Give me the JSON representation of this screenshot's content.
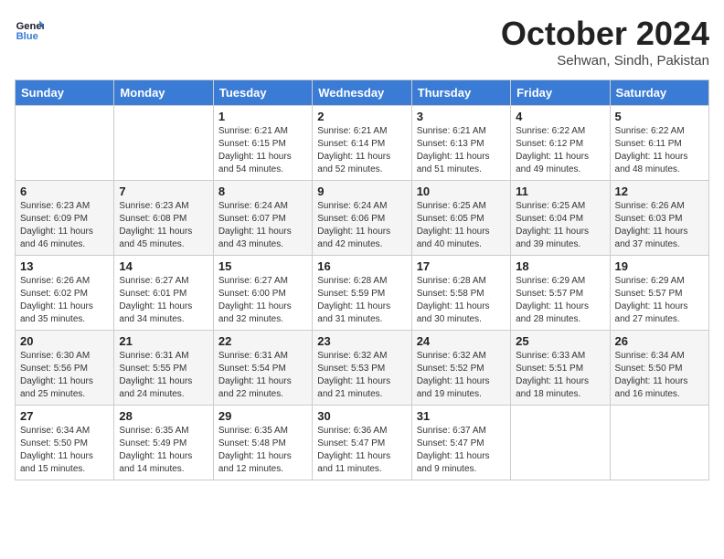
{
  "header": {
    "logo_line1": "General",
    "logo_line2": "Blue",
    "month_title": "October 2024",
    "location": "Sehwan, Sindh, Pakistan"
  },
  "days_of_week": [
    "Sunday",
    "Monday",
    "Tuesday",
    "Wednesday",
    "Thursday",
    "Friday",
    "Saturday"
  ],
  "weeks": [
    [
      {
        "num": "",
        "info": ""
      },
      {
        "num": "",
        "info": ""
      },
      {
        "num": "1",
        "info": "Sunrise: 6:21 AM\nSunset: 6:15 PM\nDaylight: 11 hours and 54 minutes."
      },
      {
        "num": "2",
        "info": "Sunrise: 6:21 AM\nSunset: 6:14 PM\nDaylight: 11 hours and 52 minutes."
      },
      {
        "num": "3",
        "info": "Sunrise: 6:21 AM\nSunset: 6:13 PM\nDaylight: 11 hours and 51 minutes."
      },
      {
        "num": "4",
        "info": "Sunrise: 6:22 AM\nSunset: 6:12 PM\nDaylight: 11 hours and 49 minutes."
      },
      {
        "num": "5",
        "info": "Sunrise: 6:22 AM\nSunset: 6:11 PM\nDaylight: 11 hours and 48 minutes."
      }
    ],
    [
      {
        "num": "6",
        "info": "Sunrise: 6:23 AM\nSunset: 6:09 PM\nDaylight: 11 hours and 46 minutes."
      },
      {
        "num": "7",
        "info": "Sunrise: 6:23 AM\nSunset: 6:08 PM\nDaylight: 11 hours and 45 minutes."
      },
      {
        "num": "8",
        "info": "Sunrise: 6:24 AM\nSunset: 6:07 PM\nDaylight: 11 hours and 43 minutes."
      },
      {
        "num": "9",
        "info": "Sunrise: 6:24 AM\nSunset: 6:06 PM\nDaylight: 11 hours and 42 minutes."
      },
      {
        "num": "10",
        "info": "Sunrise: 6:25 AM\nSunset: 6:05 PM\nDaylight: 11 hours and 40 minutes."
      },
      {
        "num": "11",
        "info": "Sunrise: 6:25 AM\nSunset: 6:04 PM\nDaylight: 11 hours and 39 minutes."
      },
      {
        "num": "12",
        "info": "Sunrise: 6:26 AM\nSunset: 6:03 PM\nDaylight: 11 hours and 37 minutes."
      }
    ],
    [
      {
        "num": "13",
        "info": "Sunrise: 6:26 AM\nSunset: 6:02 PM\nDaylight: 11 hours and 35 minutes."
      },
      {
        "num": "14",
        "info": "Sunrise: 6:27 AM\nSunset: 6:01 PM\nDaylight: 11 hours and 34 minutes."
      },
      {
        "num": "15",
        "info": "Sunrise: 6:27 AM\nSunset: 6:00 PM\nDaylight: 11 hours and 32 minutes."
      },
      {
        "num": "16",
        "info": "Sunrise: 6:28 AM\nSunset: 5:59 PM\nDaylight: 11 hours and 31 minutes."
      },
      {
        "num": "17",
        "info": "Sunrise: 6:28 AM\nSunset: 5:58 PM\nDaylight: 11 hours and 30 minutes."
      },
      {
        "num": "18",
        "info": "Sunrise: 6:29 AM\nSunset: 5:57 PM\nDaylight: 11 hours and 28 minutes."
      },
      {
        "num": "19",
        "info": "Sunrise: 6:29 AM\nSunset: 5:57 PM\nDaylight: 11 hours and 27 minutes."
      }
    ],
    [
      {
        "num": "20",
        "info": "Sunrise: 6:30 AM\nSunset: 5:56 PM\nDaylight: 11 hours and 25 minutes."
      },
      {
        "num": "21",
        "info": "Sunrise: 6:31 AM\nSunset: 5:55 PM\nDaylight: 11 hours and 24 minutes."
      },
      {
        "num": "22",
        "info": "Sunrise: 6:31 AM\nSunset: 5:54 PM\nDaylight: 11 hours and 22 minutes."
      },
      {
        "num": "23",
        "info": "Sunrise: 6:32 AM\nSunset: 5:53 PM\nDaylight: 11 hours and 21 minutes."
      },
      {
        "num": "24",
        "info": "Sunrise: 6:32 AM\nSunset: 5:52 PM\nDaylight: 11 hours and 19 minutes."
      },
      {
        "num": "25",
        "info": "Sunrise: 6:33 AM\nSunset: 5:51 PM\nDaylight: 11 hours and 18 minutes."
      },
      {
        "num": "26",
        "info": "Sunrise: 6:34 AM\nSunset: 5:50 PM\nDaylight: 11 hours and 16 minutes."
      }
    ],
    [
      {
        "num": "27",
        "info": "Sunrise: 6:34 AM\nSunset: 5:50 PM\nDaylight: 11 hours and 15 minutes."
      },
      {
        "num": "28",
        "info": "Sunrise: 6:35 AM\nSunset: 5:49 PM\nDaylight: 11 hours and 14 minutes."
      },
      {
        "num": "29",
        "info": "Sunrise: 6:35 AM\nSunset: 5:48 PM\nDaylight: 11 hours and 12 minutes."
      },
      {
        "num": "30",
        "info": "Sunrise: 6:36 AM\nSunset: 5:47 PM\nDaylight: 11 hours and 11 minutes."
      },
      {
        "num": "31",
        "info": "Sunrise: 6:37 AM\nSunset: 5:47 PM\nDaylight: 11 hours and 9 minutes."
      },
      {
        "num": "",
        "info": ""
      },
      {
        "num": "",
        "info": ""
      }
    ]
  ]
}
